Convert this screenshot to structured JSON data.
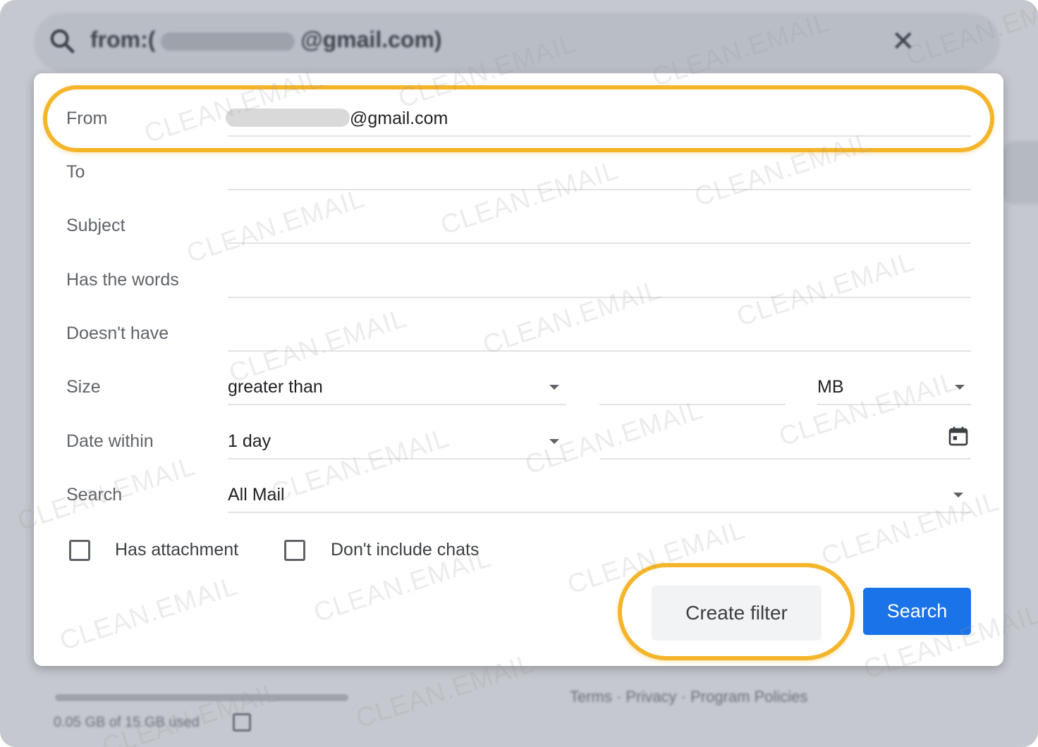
{
  "background": {
    "search_query_prefix": "from:(",
    "search_query_suffix": "@gmail.com)",
    "footer_links": "Terms · Privacy · Program Policies",
    "storage_text": "0.05 GB of 15 GB used"
  },
  "dialog": {
    "from": {
      "label": "From",
      "value_suffix": "@gmail.com"
    },
    "to": {
      "label": "To",
      "value": ""
    },
    "subject": {
      "label": "Subject",
      "value": ""
    },
    "has_words": {
      "label": "Has the words",
      "value": ""
    },
    "doesnt_have": {
      "label": "Doesn't have",
      "value": ""
    },
    "size": {
      "label": "Size",
      "comparator": "greater than",
      "amount": "",
      "unit": "MB"
    },
    "date_within": {
      "label": "Date within",
      "range": "1 day",
      "date": ""
    },
    "search": {
      "label": "Search",
      "scope": "All Mail"
    },
    "has_attachment": {
      "label": "Has attachment",
      "checked": false
    },
    "dont_include_chats": {
      "label": "Don't include chats",
      "checked": false
    },
    "create_filter_label": "Create filter",
    "search_button_label": "Search"
  },
  "watermark": "CLEAN.EMAIL",
  "colors": {
    "highlight": "#f4b52b",
    "primary_button": "#1a73e8",
    "overlay": "#c5c8cf"
  }
}
